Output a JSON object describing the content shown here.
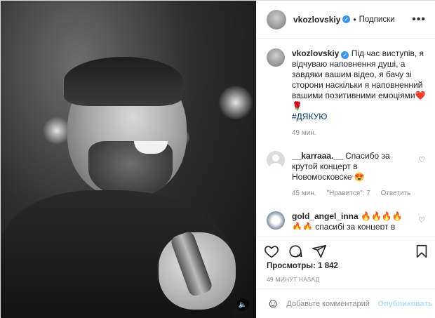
{
  "post": {
    "author": "vkozlovskiy",
    "follow_label": "Подписки",
    "dot": "•",
    "more_label": "•••",
    "caption": "Під час виступів, я відчуваю наповнення душі, а завдяки вашим відео, я бачу зі сторони наскільки я наповненний вашими позитивними емоціями❤️🌹",
    "hashtag": "#ДЯКУЮ",
    "caption_time": "49 мин."
  },
  "comments": [
    {
      "username": "__karraaa.__",
      "text": "Спасибо за крутой концерт в Новомосковске 😍",
      "time": "45 мин.",
      "likes": "\"Нравится\": 7",
      "reply": "Ответить"
    },
    {
      "username": "gold_angel_inna",
      "text": "🔥🔥🔥🔥🔥🔥 спасибі за концерт в Новомосковську❤️😘😘😘😍",
      "time": "",
      "likes": "",
      "reply": ""
    }
  ],
  "stats": {
    "views_label": "Просмотры:",
    "views_count": "1 842",
    "time_ago": "49 МИНУТ НАЗАД"
  },
  "compose": {
    "placeholder": "Добавьте комментарий...",
    "publish_label": "Опубликовать"
  },
  "icons": {
    "verified": "verified-badge-icon",
    "heart": "heart-icon",
    "comment": "comment-icon",
    "share": "share-icon",
    "bookmark": "bookmark-icon",
    "emoji": "emoji-icon",
    "mute": "speaker-icon"
  },
  "colors": {
    "verified_blue": "#3897f0",
    "hashtag": "#00376b",
    "muted_text": "#8e8e8e",
    "publish_disabled": "#b2dffc"
  }
}
